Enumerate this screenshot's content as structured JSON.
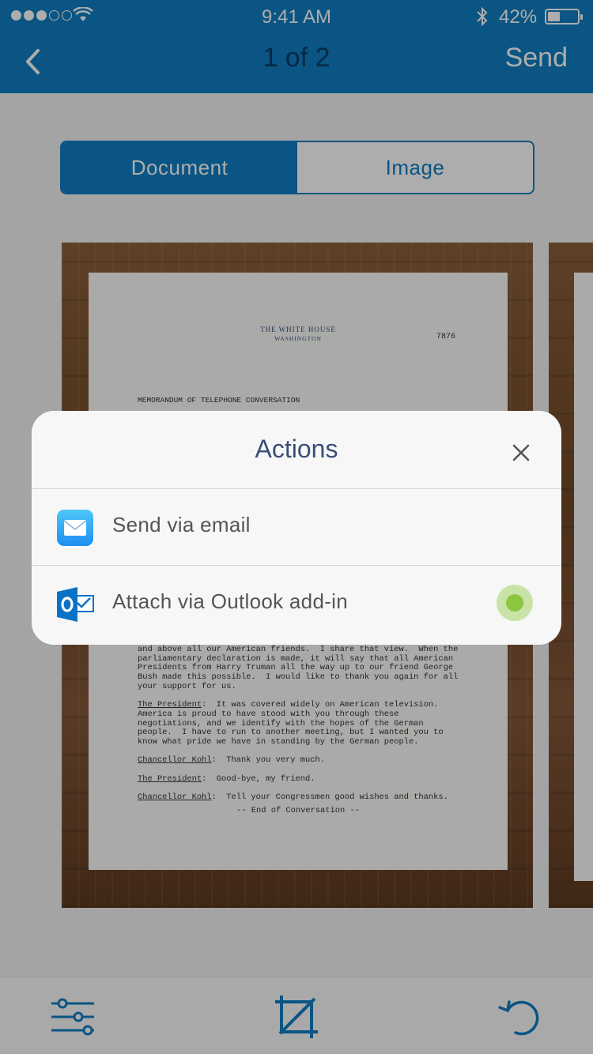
{
  "status_bar": {
    "time": "9:41 AM",
    "battery_percent": "42%",
    "battery_level": 0.42,
    "signal_bars_filled": 3,
    "signal_bars_total": 5
  },
  "nav": {
    "title": "1 of 2",
    "send_label": "Send"
  },
  "segment": {
    "options": [
      "Document",
      "Image"
    ],
    "selected": "Document"
  },
  "document": {
    "letterhead_line1": "THE WHITE HOUSE",
    "letterhead_line2": "WASHINGTON",
    "doc_number": "7876",
    "heading": "MEMORANDUM OF TELEPHONE CONVERSATION",
    "body_line1": "and above all our American friends.  I share that view.  When the",
    "body_line2": "parliamentary declaration is made, it will say that all American",
    "body_line3": "Presidents from Harry Truman all the way up to our friend George",
    "body_line4": "Bush made this possible.  I would like to thank you again for all",
    "body_line5": "your support for us.",
    "speaker_president": "The President",
    "president_text1": "  It was covered widely on American television.",
    "president_text2": "America is proud to have stood with you through these",
    "president_text3": "negotiations, and we identify with the hopes of the German",
    "president_text4": "people.  I have to run to another meeting, but I wanted you to",
    "president_text5": "know what pride we have in standing by the German people.",
    "speaker_kohl": "Chancellor Kohl",
    "kohl_text1": "  Thank you very much.",
    "president_text6": "  Good-bye, my friend.",
    "kohl_text2": "  Tell your Congressmen good wishes and thanks.",
    "end_text": "-- End of Conversation --"
  },
  "actions_sheet": {
    "title": "Actions",
    "items": [
      {
        "label": "Send via email",
        "icon": "mail-icon"
      },
      {
        "label": "Attach via Outlook add-in",
        "icon": "outlook-icon",
        "toggle_on": true
      }
    ]
  },
  "toolbar": {
    "icons": [
      "sliders-icon",
      "crop-icon",
      "rotate-icon"
    ]
  },
  "colors": {
    "brand_blue": "#0f7ec2",
    "title_navy": "#3a4e78",
    "toggle_green": "#8dc63f"
  }
}
